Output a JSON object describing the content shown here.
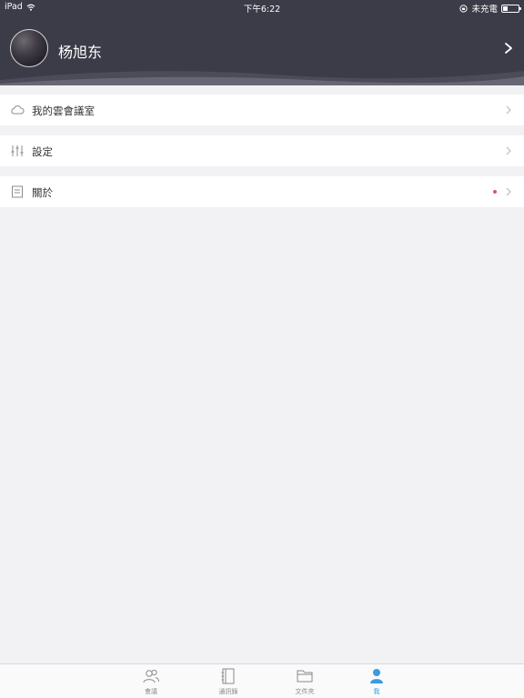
{
  "status_bar": {
    "device": "iPad",
    "time": "下午6:22",
    "charging_status": "未充電",
    "battery_level": 0.3
  },
  "profile": {
    "name": "杨旭东"
  },
  "menu": [
    {
      "label": "我的雲會議室",
      "icon": "cloud-icon"
    },
    {
      "label": "設定",
      "icon": "sliders-icon"
    },
    {
      "label": "關於",
      "icon": "document-icon",
      "badge": true
    }
  ],
  "tabs": [
    {
      "label": "會議",
      "icon": "people-icon",
      "active": false
    },
    {
      "label": "通訊錄",
      "icon": "contacts-book-icon",
      "active": false
    },
    {
      "label": "文件夾",
      "icon": "folder-icon",
      "active": false
    },
    {
      "label": "我",
      "icon": "person-icon",
      "active": true
    }
  ],
  "colors": {
    "header_bg": "#3c3b48",
    "page_bg": "#f2f2f4",
    "accent": "#3b9ae1",
    "badge": "#e0555e"
  }
}
